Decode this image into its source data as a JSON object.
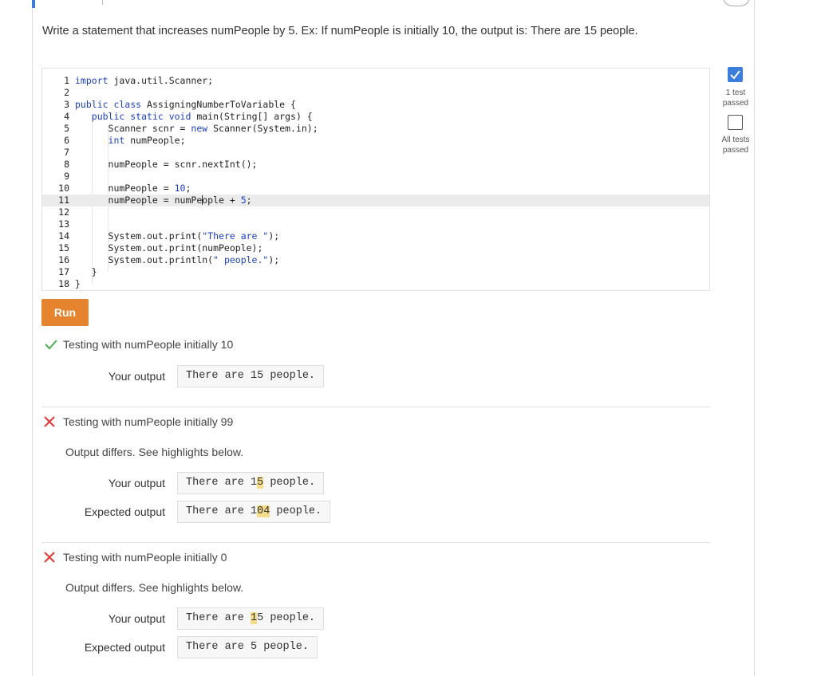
{
  "prompt": "Write a statement that increases numPeople by 5. Ex: If numPeople is initially 10, the output is: There are 15 people.",
  "editor": {
    "line_numbers": [
      "1",
      "2",
      "3",
      "4",
      "5",
      "6",
      "7",
      "8",
      "9",
      "10",
      "11",
      "12",
      "13",
      "14",
      "15",
      "16",
      "17",
      "18"
    ],
    "active_line": "11"
  },
  "run_label": "Run",
  "tests": [
    {
      "status": "pass",
      "title": "Testing with numPeople initially 10",
      "your_output_label": "Your output",
      "your_output": "There are 15 people."
    },
    {
      "status": "fail",
      "title": "Testing with numPeople initially 99",
      "message": "Output differs. See highlights below.",
      "your_output_label": "Your output",
      "your_output_pre": "There are 1",
      "your_output_diff": "5",
      "your_output_post": " people.",
      "expected_label": "Expected output",
      "expected_pre": "There are 1",
      "expected_diff": "04",
      "expected_post": " people."
    },
    {
      "status": "fail",
      "title": "Testing with numPeople initially 0",
      "message": "Output differs. See highlights below.",
      "your_output_label": "Your output",
      "your_output_pre": "There are ",
      "your_output_diff": "1",
      "your_output_post": "5 people.",
      "expected_label": "Expected output",
      "expected_output": "There are 5 people."
    }
  ],
  "side": {
    "test1_line1": "1 test",
    "test1_line2": "passed",
    "all_line1": "All tests",
    "all_line2": "passed"
  },
  "colors": {
    "accent": "#3b7ddd",
    "run_button": "#e5832e",
    "pass": "#4caf50",
    "fail": "#e53935",
    "diff_highlight": "#f6dd8b"
  }
}
